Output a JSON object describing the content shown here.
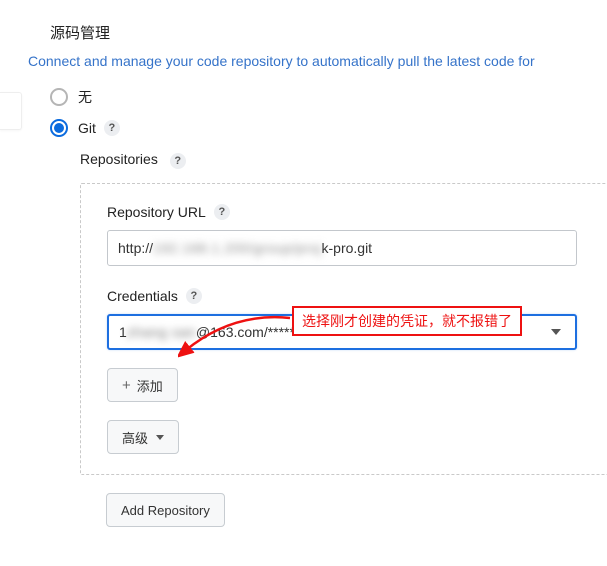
{
  "section": {
    "title": "源码管理",
    "desc": "Connect and manage your code repository to automatically pull the latest code for"
  },
  "scm": {
    "options": {
      "none_label": "无",
      "git_label": "Git"
    },
    "repos_heading": "Repositories"
  },
  "repo": {
    "url_label": "Repository URL",
    "url_prefix": "http:// ",
    "url_mid_blur": "192.168.1.200/group/proj",
    "url_suffix": "k-pro.git",
    "cred_label": "Credentials",
    "cred_prefix": "1 ",
    "cred_blur": "zhang san",
    "cred_suffix": "@163.com/******",
    "add_btn": "添加",
    "adv_btn": "高级"
  },
  "add_repo_btn": "Add Repository",
  "annotation": {
    "text": "选择刚才创建的凭证，就不报错了"
  },
  "help_glyph": "?"
}
